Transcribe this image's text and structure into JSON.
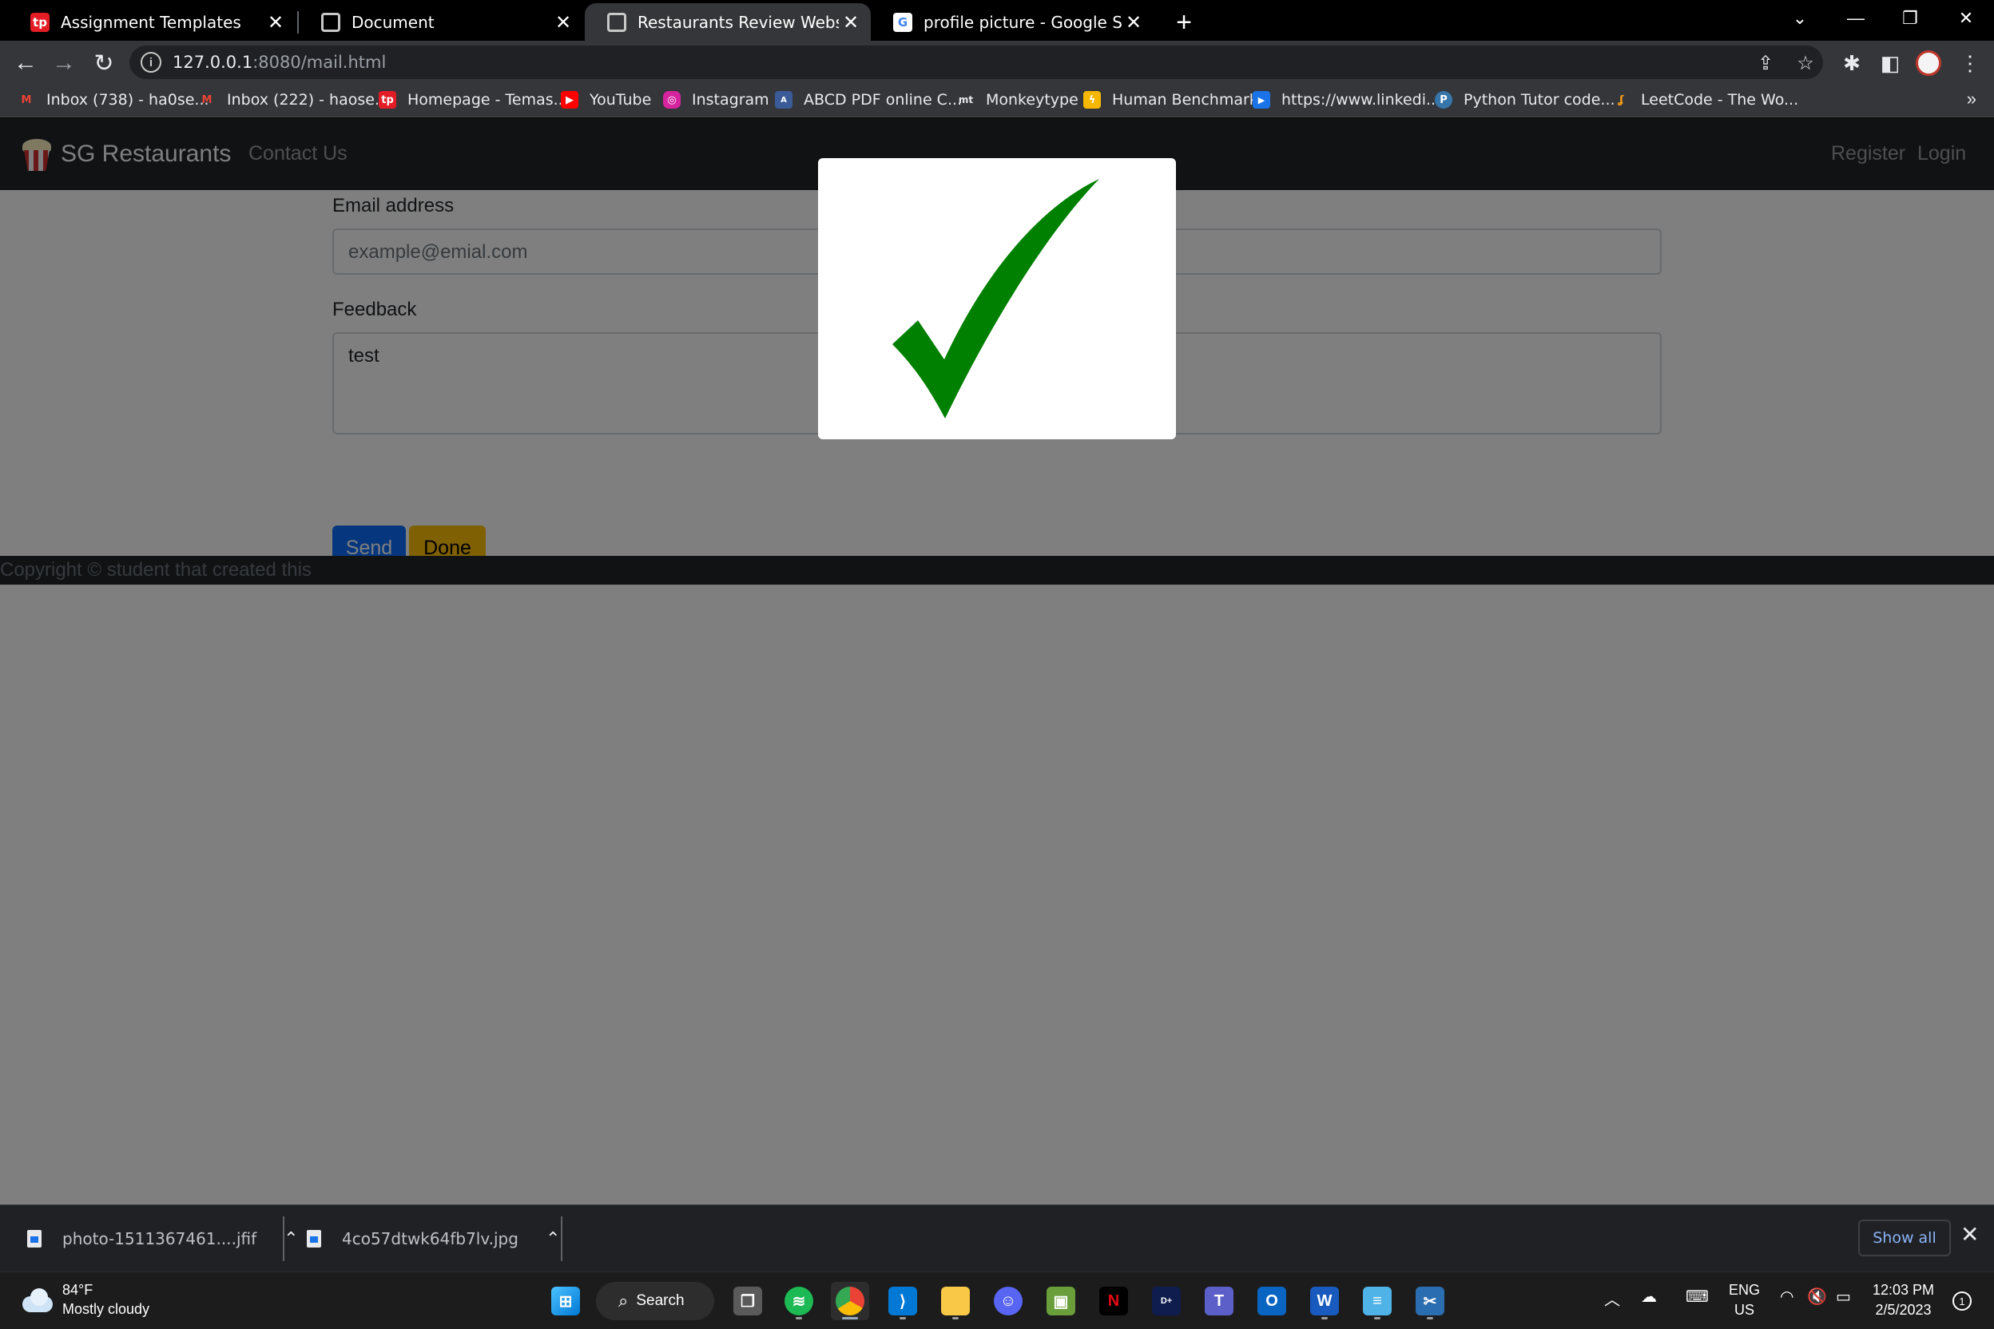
{
  "browser": {
    "tabs": [
      {
        "label": "Assignment Templates",
        "icon": "tp-icon"
      },
      {
        "label": "Document",
        "icon": "globe-icon"
      },
      {
        "label": "Restaurants Review Website",
        "icon": "globe-icon",
        "active": true
      },
      {
        "label": "profile picture - Google Search",
        "icon": "google-icon"
      }
    ],
    "url_host": "127.0.0.1",
    "url_rest": ":8080/mail.html",
    "bookmarks": [
      {
        "label": "Inbox (738) - ha0se...",
        "icon": "gmail-icon"
      },
      {
        "label": "Inbox (222) - haose...",
        "icon": "gmail-icon"
      },
      {
        "label": "Homepage - Temas...",
        "icon": "tp-icon"
      },
      {
        "label": "YouTube",
        "icon": "youtube-icon"
      },
      {
        "label": "Instagram",
        "icon": "instagram-icon"
      },
      {
        "label": "ABCD PDF online C...",
        "icon": "abcd-icon"
      },
      {
        "label": "Monkeytype",
        "icon": "monkeytype-icon"
      },
      {
        "label": "Human Benchmark",
        "icon": "lightning-icon"
      },
      {
        "label": "https://www.linkedi...",
        "icon": "linkedin-icon"
      },
      {
        "label": "Python Tutor code...",
        "icon": "python-icon"
      },
      {
        "label": "LeetCode - The Wo...",
        "icon": "leetcode-icon"
      }
    ]
  },
  "site": {
    "brand": "SG Restaurants",
    "nav": {
      "contact": "Contact Us",
      "register": "Register",
      "login": "Login"
    },
    "form": {
      "email_label": "Email address",
      "email_placeholder": "example@emial.com",
      "feedback_label": "Feedback",
      "feedback_value": "test",
      "send": "Send",
      "done": "Done"
    },
    "footer": "Copyright © student that created this",
    "modal": {
      "icon": "checkmark-icon",
      "color": "#008000"
    }
  },
  "downloads": {
    "items": [
      {
        "label": "photo-1511367461....jfif"
      },
      {
        "label": "4co57dtwk64fb7lv.jpg"
      }
    ],
    "show_all": "Show all"
  },
  "taskbar": {
    "weather_temp": "84°F",
    "weather_desc": "Mostly cloudy",
    "search": "Search",
    "lang_1": "ENG",
    "lang_2": "US",
    "time": "12:03 PM",
    "date": "2/5/2023",
    "notifications": "1"
  }
}
